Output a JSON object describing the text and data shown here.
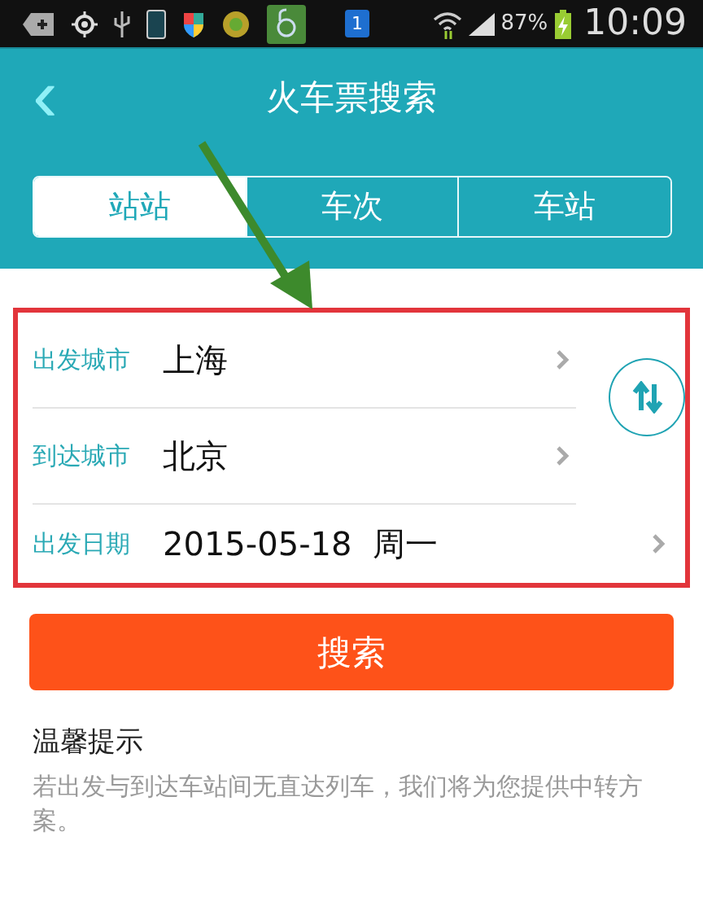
{
  "status_bar": {
    "notification_count": "1",
    "battery": "87%",
    "time": "10:09"
  },
  "header": {
    "back_icon": "‹",
    "title": "火车票搜索"
  },
  "tabs": [
    {
      "label": "站站",
      "selected": true
    },
    {
      "label": "车次",
      "selected": false
    },
    {
      "label": "车站",
      "selected": false
    }
  ],
  "form": {
    "fields": [
      {
        "label": "出发城市",
        "value": "上海"
      },
      {
        "label": "到达城市",
        "value": "北京"
      },
      {
        "label": "出发日期",
        "value": "2015-05-18  周一"
      }
    ]
  },
  "search_button": "搜索",
  "tips": {
    "title": "温馨提示",
    "text": "若出发与到达车站间无直达列车，我们将为您提供中转方案。"
  }
}
